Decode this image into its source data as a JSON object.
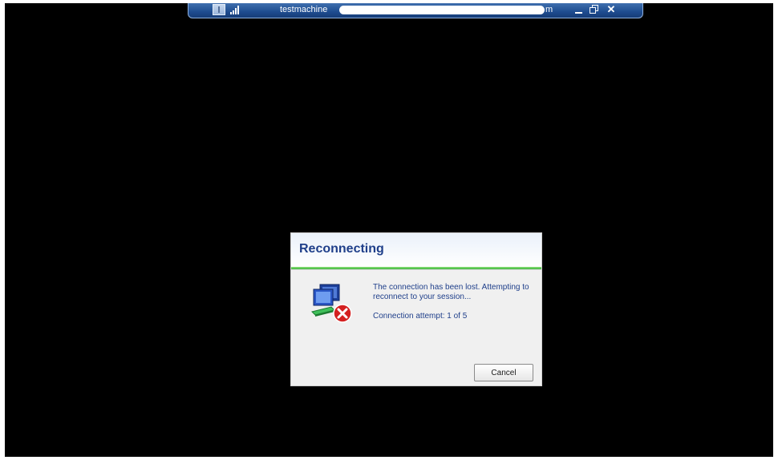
{
  "connection_bar": {
    "title": "testmachine",
    "title_suffix": "m",
    "pin_icon": "pin-icon",
    "signal_icon": "connection-quality-icon",
    "minimize_icon": "minimize-icon",
    "restore_icon": "restore-icon",
    "close_icon": "close-icon",
    "close_glyph": "✕"
  },
  "dialog": {
    "title": "Reconnecting",
    "icon": "network-error-icon",
    "message": "The connection has been lost. Attempting to reconnect to your session...",
    "attempt_text": "Connection attempt: 1 of 5",
    "cancel_label": "Cancel"
  },
  "colors": {
    "title_text": "#1f3f8a",
    "bar_blue": "#1e4c8f",
    "progress_green": "#3cb43c",
    "error_red": "#d42020"
  }
}
